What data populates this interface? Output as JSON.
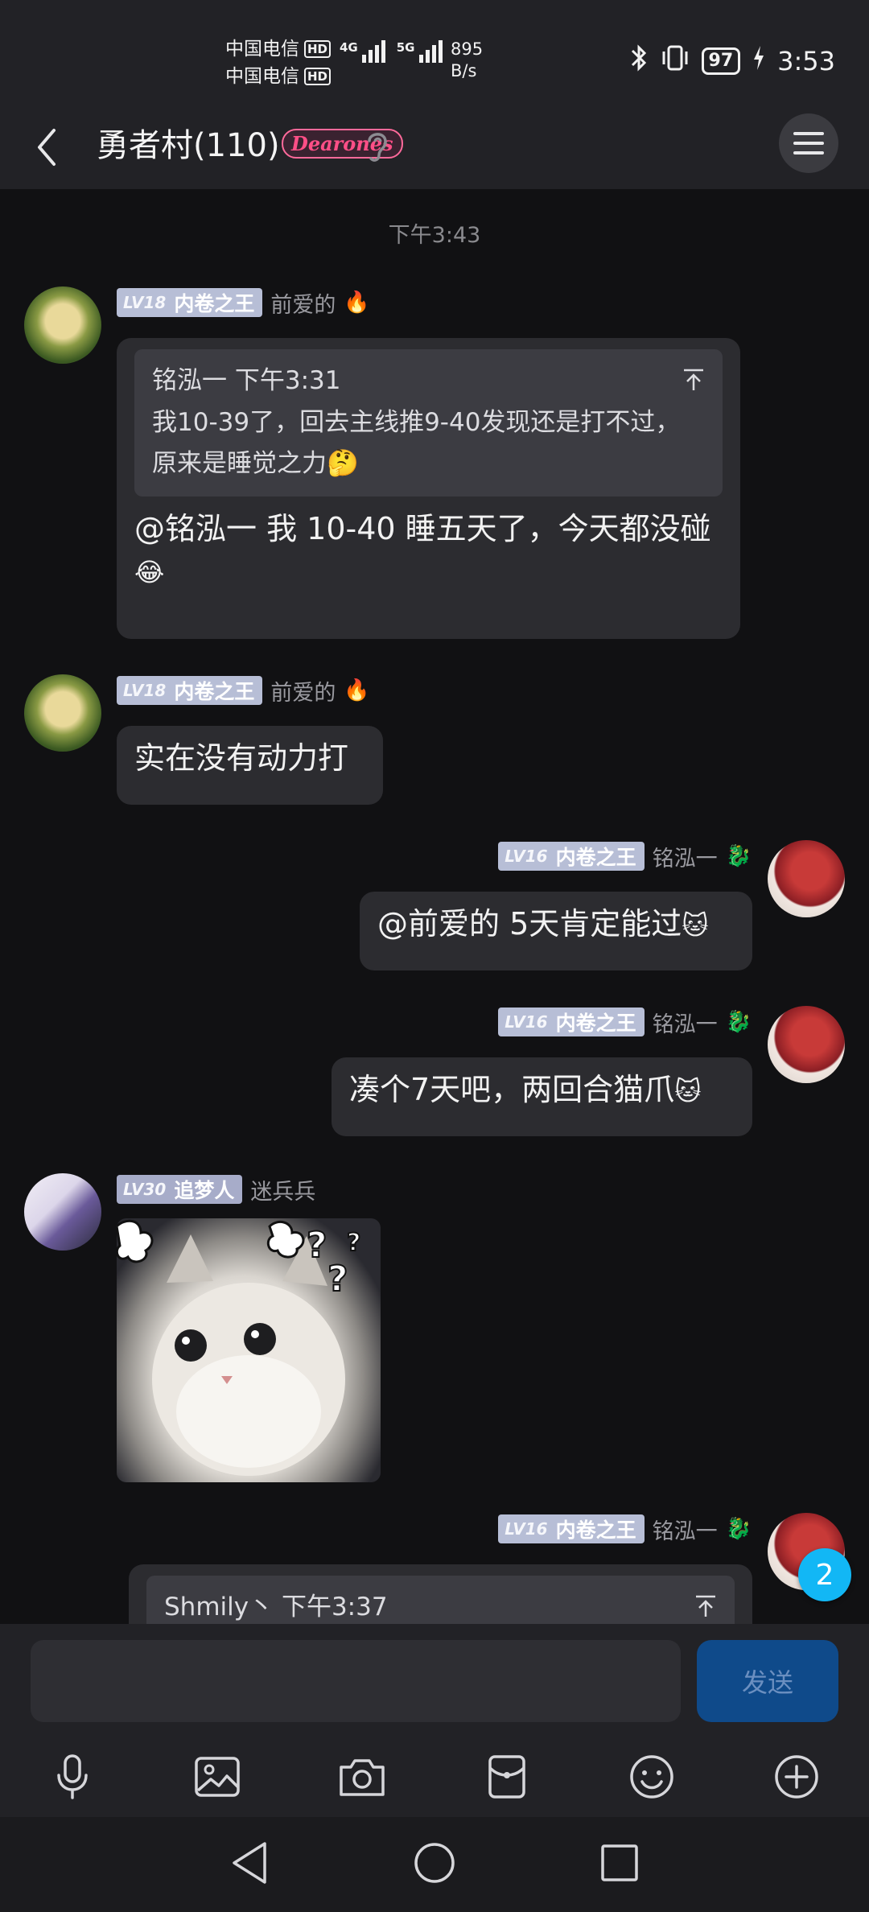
{
  "status": {
    "carrier1": "中国电信",
    "carrier2": "中国电信",
    "hd": "HD",
    "net1": "4G",
    "net2": "5G",
    "speed_value": "895",
    "speed_unit": "B/s",
    "battery": "97",
    "time": "3:53"
  },
  "header": {
    "title": "勇者村(110)",
    "badge": "Dearones"
  },
  "timestamp": "下午3:43",
  "messages": [
    {
      "level": "LV18",
      "title": "内卷之王",
      "sender": "前爱的",
      "quote_author_time": "铭泓一 下午3:31",
      "quote_text": "我10-39了，回去主线推9-40发现还是打不过，原来是睡觉之力",
      "text": "@铭泓一 我 10-40 睡五天了，今天都没碰"
    },
    {
      "level": "LV18",
      "title": "内卷之王",
      "sender": "前爱的",
      "text": "实在没有动力打"
    },
    {
      "level": "LV16",
      "title": "内卷之王",
      "sender": "铭泓一",
      "text": "@前爱的 5天肯定能过"
    },
    {
      "level": "LV16",
      "title": "内卷之王",
      "sender": "铭泓一",
      "text": "凑个7天吧，两回合猫爪"
    },
    {
      "level": "LV30",
      "title": "追梦人",
      "sender": "迷兵兵"
    },
    {
      "level": "LV16",
      "title": "内卷之王",
      "sender": "铭泓一",
      "quote_author_time": "Shmily丶 下午3:37"
    }
  ],
  "unread_count": "2",
  "input": {
    "placeholder": "",
    "send_label": "发送"
  },
  "toolbar": [
    "mic-icon",
    "image-icon",
    "camera-icon",
    "red-packet-icon",
    "emoji-icon",
    "plus-icon"
  ]
}
